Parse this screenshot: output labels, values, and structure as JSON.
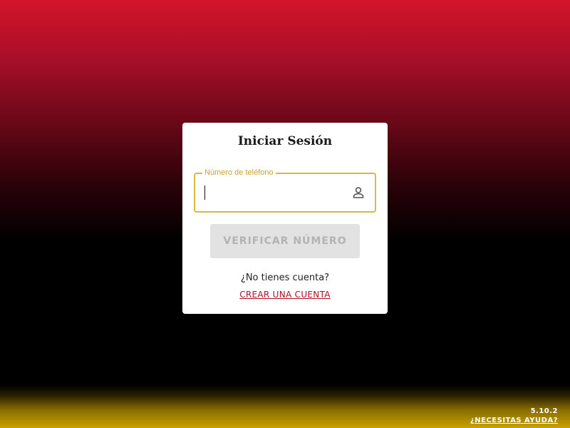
{
  "login": {
    "title": "Iniciar Sesión",
    "phone_label": "Número de teléfono",
    "phone_value": "",
    "phone_icon": "person-icon",
    "verify_label": "VERIFICAR NÚMERO",
    "no_account_text": "¿No tienes cuenta?",
    "create_account_label": "CREAR UNA CUENTA"
  },
  "footer": {
    "version": "5.10.2",
    "help_label": "¿NECESITAS AYUDA?"
  },
  "colors": {
    "brand_red": "#d2142a",
    "brand_gold": "#c9a100",
    "field_border": "#d8b946",
    "button_disabled_bg": "#e2e2e2",
    "button_disabled_text": "#b3b3b3",
    "link_red": "#b0102a"
  }
}
